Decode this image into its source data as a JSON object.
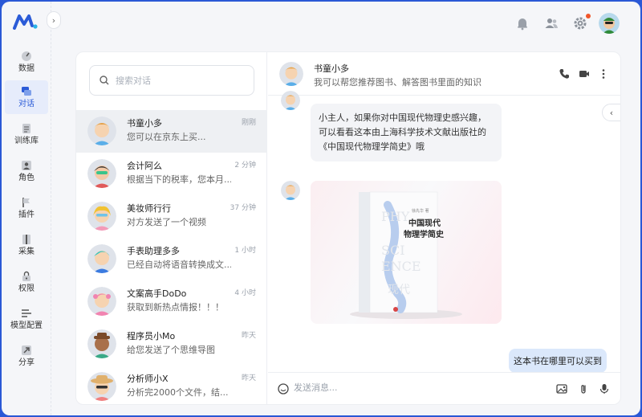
{
  "nav": {
    "items": [
      {
        "key": "data",
        "label": "数据",
        "icon": "dashboard-icon"
      },
      {
        "key": "chat",
        "label": "对话",
        "icon": "chat-icon",
        "active": true
      },
      {
        "key": "train",
        "label": "训练库",
        "icon": "document-icon"
      },
      {
        "key": "role",
        "label": "角色",
        "icon": "person-icon"
      },
      {
        "key": "plugin",
        "label": "插件",
        "icon": "flag-icon"
      },
      {
        "key": "collect",
        "label": "采集",
        "icon": "book-icon"
      },
      {
        "key": "perm",
        "label": "权限",
        "icon": "lock-icon"
      },
      {
        "key": "model",
        "label": "模型配置",
        "icon": "sliders-icon"
      },
      {
        "key": "share",
        "label": "分享",
        "icon": "share-icon"
      }
    ]
  },
  "search": {
    "placeholder": "搜索对话"
  },
  "conversations": [
    {
      "name": "书童小多",
      "time": "刚刚",
      "preview": "您可以在京东上买..."
    },
    {
      "name": "会计阿么",
      "time": "2 分钟",
      "preview": "根据当下的税率，您本月..."
    },
    {
      "name": "美妆师行行",
      "time": "37 分钟",
      "preview": "对方发送了一个视频"
    },
    {
      "name": "手表助理多多",
      "time": "1 小时",
      "preview": "已经自动将语音转换成文..."
    },
    {
      "name": "文案高手DoDo",
      "time": "4 小时",
      "preview": "获取到新热点情报！！！"
    },
    {
      "name": "程序员小Mo",
      "time": "昨天",
      "preview": "给您发送了个思维导图"
    },
    {
      "name": "分析师小X",
      "time": "昨天",
      "preview": "分析完2000个文件，结..."
    }
  ],
  "chat": {
    "title": "书童小多",
    "subtitle": "我可以帮您推荐图书、解答图书里面的知识",
    "bot_message": "小主人，如果你对中国现代物理史感兴趣，可以看看这本由上海科学技术文献出版社的《中国现代物理学简史》哦",
    "book": {
      "title_line1": "中国现代",
      "title_line2": "物理学简史",
      "author": "徐先华 著"
    },
    "user_message": "这本书在哪里可以买到",
    "composer_placeholder": "发送消息..."
  },
  "colors": {
    "accent": "#2b5bd7",
    "user_bubble": "#dbe8fb",
    "notify_dot": "#f0562a"
  }
}
